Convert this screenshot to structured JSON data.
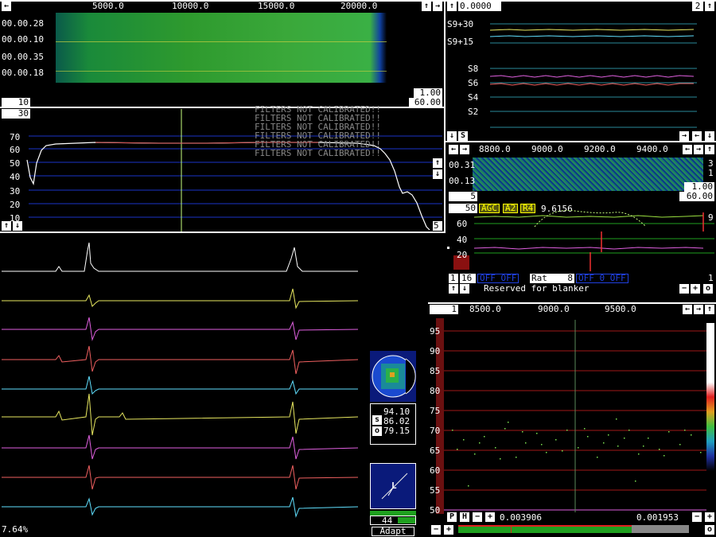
{
  "top_waterfall": {
    "freq_ticks": [
      "5000.0",
      "10000.0",
      "15000.0",
      "20000.0"
    ],
    "times": [
      "00.00.28",
      "00.00.10",
      "00.00.35",
      "00.00.18"
    ],
    "box_gain": "1.00",
    "box_speed": "60.00",
    "box_left": "10"
  },
  "baseline": {
    "box_top": "30",
    "y_ticks": [
      "70",
      "60",
      "50",
      "40",
      "30",
      "20",
      "10"
    ],
    "filters_msg": "FILTERS NOT CALIBRATED!!",
    "box_right": "5"
  },
  "smeter": {
    "top_value": "0.0000",
    "top_right_box": "2",
    "labels": [
      "S9+30",
      "S9+15",
      "S8",
      "S6",
      "S4",
      "S2"
    ],
    "s_button": "S"
  },
  "hires_waterfall": {
    "freq_ticks": [
      "8800.0",
      "9000.0",
      "9200.0",
      "9400.0"
    ],
    "times": [
      "00.31",
      "00.13"
    ],
    "right_nums": [
      "3",
      "1"
    ],
    "box_gain": "1.00",
    "box_speed": "60.00",
    "box_left": "5"
  },
  "hires_graph": {
    "box_50": "50",
    "agc": "AGC",
    "a2": "A2",
    "r4": "R4",
    "freq": "9.6156",
    "y_ticks": [
      "60",
      "40",
      "20"
    ],
    "right_num": "9",
    "bottom_left_1": "1",
    "bottom_left_16": "16",
    "blank_left": "OFF OFF",
    "rat_label": "Rat",
    "rat_value": "8",
    "blank_right": "OFF 0 OFF",
    "blanker_msg": "Reserved for blanker",
    "right_1": "1"
  },
  "timf": {
    "percent": "7.64%"
  },
  "pol": {
    "vals": [
      "94.10",
      "86.02",
      "79.15"
    ],
    "s_btn": "s",
    "o_btn": "o"
  },
  "meter": {
    "letter": "L",
    "value": "44",
    "adapt": "Adapt"
  },
  "spectrum": {
    "top_box": "1",
    "freq_ticks": [
      "8500.0",
      "9000.0",
      "9500.0"
    ],
    "y_ticks": [
      "95",
      "90",
      "85",
      "80",
      "75",
      "70",
      "65",
      "60",
      "55",
      "50"
    ],
    "p_btn": "P",
    "h_btn": "H",
    "left_val": "0.003906",
    "right_val": "0.001953"
  },
  "colors": {
    "blue_grid": "#1a35c8",
    "red_grid": "#a01818",
    "green": "#1fa01f",
    "waterfall": "#0a7a55"
  }
}
